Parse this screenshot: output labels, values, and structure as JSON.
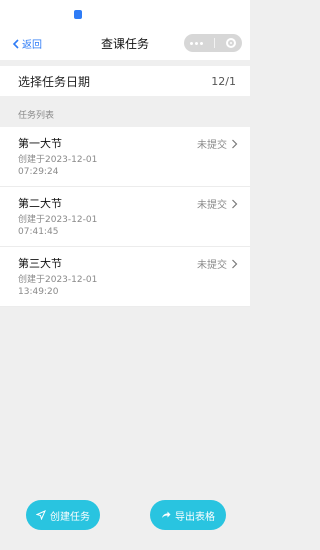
{
  "nav": {
    "back_label": "返回",
    "title": "查课任务",
    "accent": "#2f7cf6"
  },
  "date_selector": {
    "label": "选择任务日期",
    "value": "12/1"
  },
  "task_list": {
    "label": "任务列表",
    "items": [
      {
        "title": "第一大节",
        "status": "未提交",
        "created_prefix": "创建于2023-12-01",
        "created_time": "07:29:24"
      },
      {
        "title": "第二大节",
        "status": "未提交",
        "created_prefix": "创建于2023-12-01",
        "created_time": "07:41:45"
      },
      {
        "title": "第三大节",
        "status": "未提交",
        "created_prefix": "创建于2023-12-01",
        "created_time": "13:49:20"
      }
    ]
  },
  "actions": {
    "create_label": "创建任务",
    "export_label": "导出表格",
    "button_color": "#29c4e0"
  },
  "icons": [
    "chevron-left-icon",
    "more-dots-icon",
    "close-target-icon",
    "chevron-right-icon",
    "send-icon",
    "share-icon"
  ]
}
